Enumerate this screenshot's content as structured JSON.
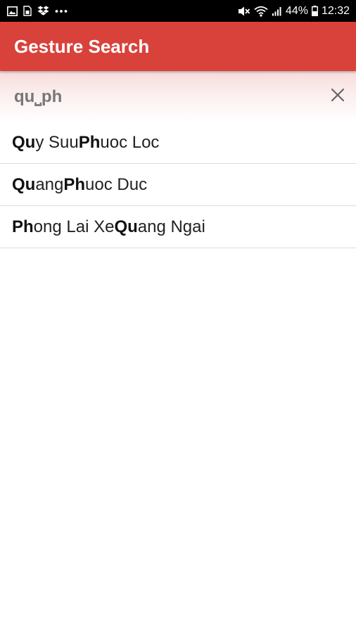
{
  "status_bar": {
    "left_icons": [
      "image-icon",
      "sim-card-icon",
      "dropbox-icon",
      "more-dots-icon"
    ],
    "right_icons": [
      "mute-icon",
      "wifi-icon",
      "signal-icon"
    ],
    "battery_percent": "44%",
    "time": "12:32"
  },
  "app_bar": {
    "title": "Gesture Search"
  },
  "search": {
    "query": "qu⎵ph",
    "clear_icon": "close-icon"
  },
  "results": [
    {
      "segments": [
        {
          "text": "Qu",
          "match": true
        },
        {
          "text": "y Suu ",
          "match": false
        },
        {
          "text": "Ph",
          "match": true
        },
        {
          "text": "uoc Loc",
          "match": false
        }
      ]
    },
    {
      "segments": [
        {
          "text": "Qu",
          "match": true
        },
        {
          "text": "ang ",
          "match": false
        },
        {
          "text": "Ph",
          "match": true
        },
        {
          "text": "uoc Duc",
          "match": false
        }
      ]
    },
    {
      "segments": [
        {
          "text": "Ph",
          "match": true
        },
        {
          "text": "ong Lai Xe ",
          "match": false
        },
        {
          "text": "Qu",
          "match": true
        },
        {
          "text": "ang Ngai",
          "match": false
        }
      ]
    }
  ],
  "colors": {
    "app_bar": "#d9423b",
    "status_bar": "#000000",
    "query_text": "#777777",
    "divider": "#dcdcdc"
  }
}
